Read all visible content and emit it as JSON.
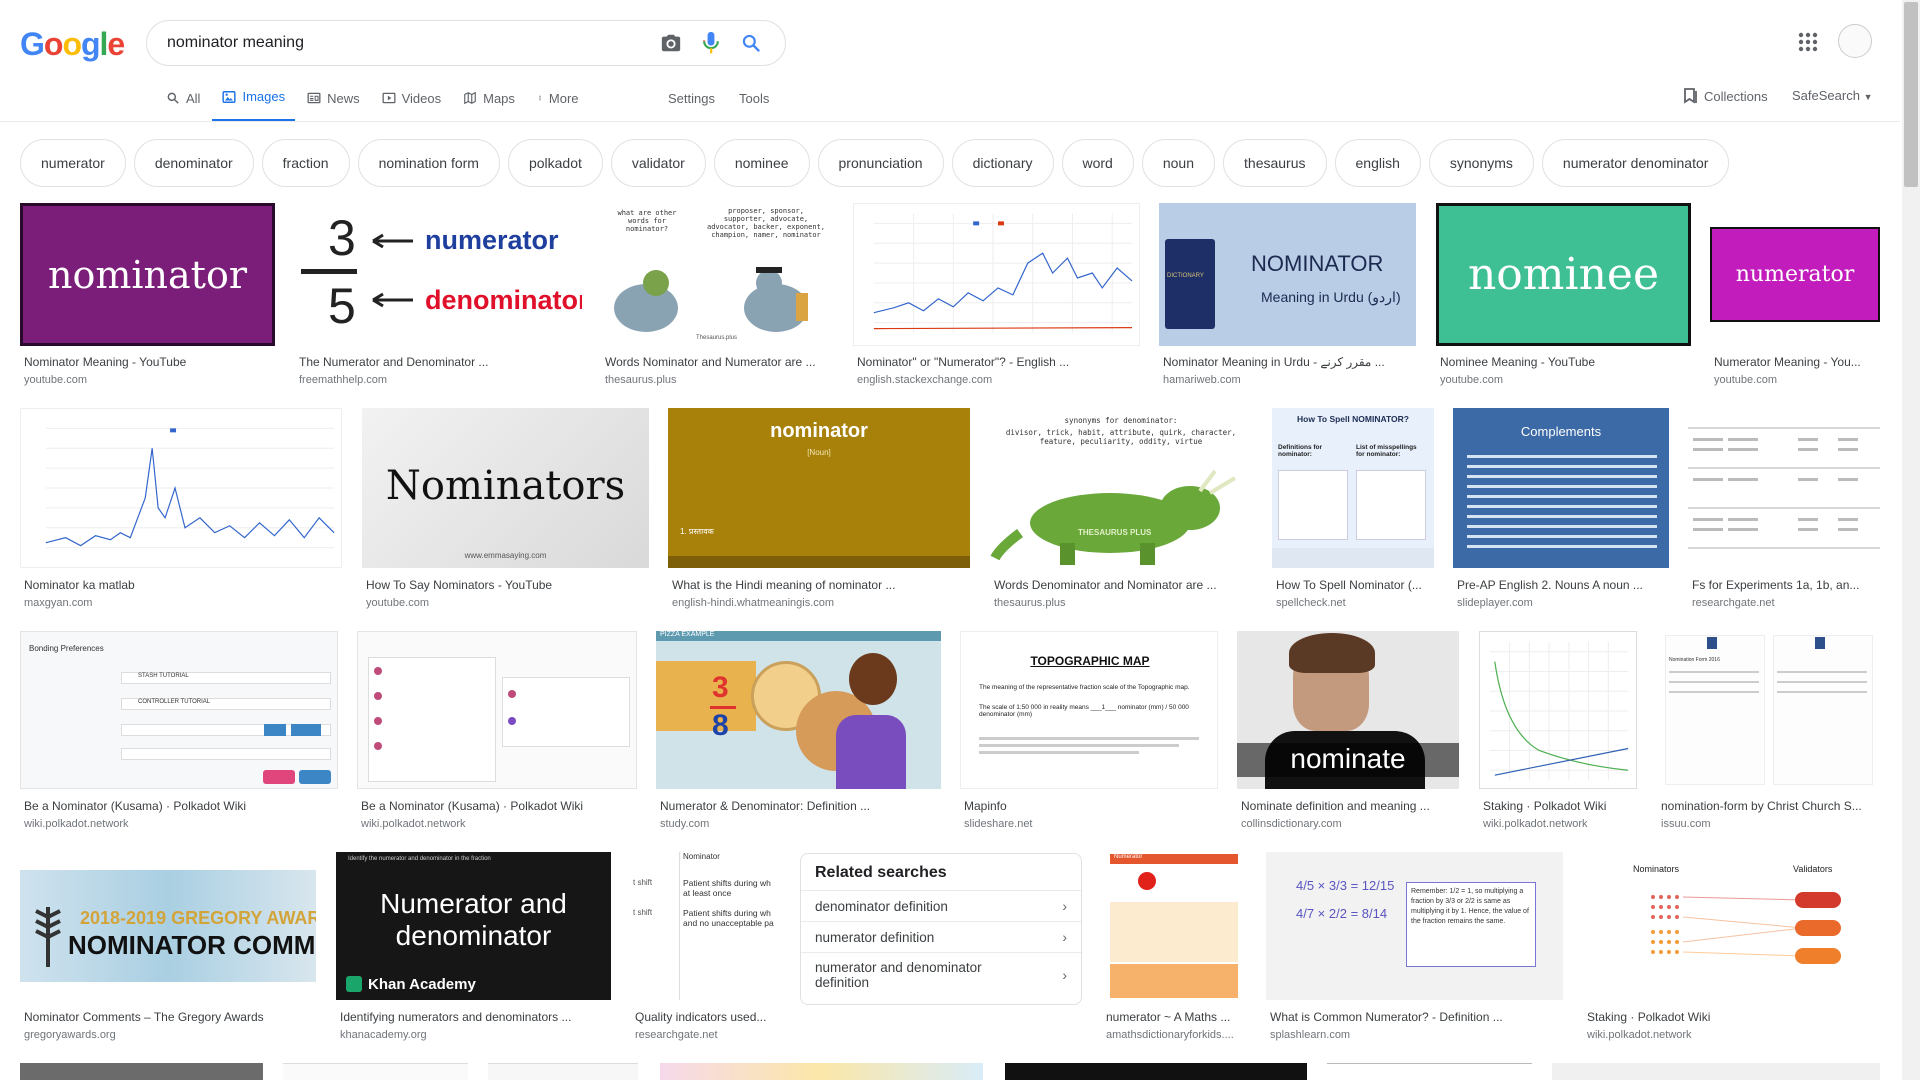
{
  "logo": [
    "G",
    "o",
    "o",
    "g",
    "l",
    "e"
  ],
  "logo_colors": [
    "#4285f4",
    "#ea4335",
    "#fbbc05",
    "#4285f4",
    "#34a853",
    "#ea4335"
  ],
  "search": {
    "value": "nominator meaning"
  },
  "tabs": [
    {
      "label": "All",
      "icon": "search-icon"
    },
    {
      "label": "Images",
      "icon": "image-icon"
    },
    {
      "label": "News",
      "icon": "news-icon"
    },
    {
      "label": "Videos",
      "icon": "video-icon"
    },
    {
      "label": "Maps",
      "icon": "map-icon"
    },
    {
      "label": "More",
      "icon": "more-vert-icon"
    }
  ],
  "tools": {
    "settings": "Settings",
    "tools": "Tools"
  },
  "collections": "Collections",
  "safesearch": "SafeSearch",
  "chips": [
    "numerator",
    "denominator",
    "fraction",
    "nomination form",
    "polkadot",
    "validator",
    "nominee",
    "pronunciation",
    "dictionary",
    "word",
    "noun",
    "thesaurus",
    "english",
    "synonyms",
    "numerator denominator"
  ],
  "results": [
    {
      "title": "Nominator Meaning - YouTube",
      "source": "youtube.com",
      "thumb_text": "nominator"
    },
    {
      "title": "The Numerator and Denominator ...",
      "source": "freemathhelp.com",
      "thumb_text": "numerator",
      "thumb_text2": "denominator",
      "num": "3",
      "den": "5"
    },
    {
      "title": "Words Nominator and Numerator are ...",
      "source": "thesaurus.plus",
      "thumb_text": "what are other words for nominator?",
      "thumb_text2": "proposer, sponsor, supporter, advocate, advocator, backer, exponent, champion, namer, nominator",
      "thumb_text3": "Thesaurus.plus"
    },
    {
      "title": "Nominator\" or \"Numerator\"? - English ...",
      "source": "english.stackexchange.com"
    },
    {
      "title": "Nominator Meaning in Urdu - مقرر کرنے ...",
      "source": "hamariweb.com",
      "thumb_text": "NOMINATOR",
      "thumb_text2": "Meaning in Urdu (اردو)",
      "thumb_text3": "DICTIONARY"
    },
    {
      "title": "Nominee Meaning - YouTube",
      "source": "youtube.com",
      "thumb_text": "nominee"
    },
    {
      "title": "Numerator Meaning - You...",
      "source": "youtube.com",
      "thumb_text": "numerator"
    },
    {
      "title": "Nominator ka matlab",
      "source": "maxgyan.com"
    },
    {
      "title": "How To Say Nominators - YouTube",
      "source": "youtube.com",
      "thumb_text": "Nominators",
      "thumb_text2": "www.emmasaying.com"
    },
    {
      "title": "What is the Hindi meaning of nominator ...",
      "source": "english-hindi.whatmeaningis.com",
      "thumb_text": "nominator",
      "thumb_text2": "[Noun]",
      "thumb_text3": "1. प्रस्तावक"
    },
    {
      "title": "Words Denominator and Nominator are ...",
      "source": "thesaurus.plus",
      "thumb_text": "synonyms for denominator:",
      "thumb_text2": "divisor, trick, habit, attribute, quirk, character, feature, peculiarity, oddity, virtue",
      "thumb_text3": "THESAURUS PLUS"
    },
    {
      "title": "How To Spell Nominator (...",
      "source": "spellcheck.net",
      "thumb_text": "How To Spell NOMINATOR?",
      "thumb_text2": "Definitions for nominator:",
      "thumb_text3": "List of misspellings for nominator:"
    },
    {
      "title": "Pre-AP English 2. Nouns A noun ...",
      "source": "slideplayer.com",
      "thumb_text": "Complements"
    },
    {
      "title": "Fs for Experiments 1a, 1b, an...",
      "source": "researchgate.net"
    },
    {
      "title": "Be a Nominator (Kusama) · Polkadot Wiki",
      "source": "wiki.polkadot.network",
      "thumb_text": "Bonding Preferences",
      "thumb_text2": "STASH TUTORIAL",
      "thumb_text3": "CONTROLLER TUTORIAL"
    },
    {
      "title": "Be a Nominator (Kusama) · Polkadot Wiki",
      "source": "wiki.polkadot.network"
    },
    {
      "title": "Numerator & Denominator: Definition ...",
      "source": "study.com",
      "thumb_text": "PIZZA EXAMPLE",
      "num": "3",
      "den": "8"
    },
    {
      "title": "Mapinfo",
      "source": "slideshare.net",
      "thumb_text": "TOPOGRAPHIC MAP",
      "thumb_text2": "The meaning of the representative fraction scale of the Topographic map.",
      "thumb_text3": "The scale of 1:50 000 in reality means ___1___ nominator (mm) / 50 000 denominator (mm)"
    },
    {
      "title": "Nominate definition and meaning ...",
      "source": "collinsdictionary.com",
      "thumb_text": "nominate"
    },
    {
      "title": "Staking · Polkadot Wiki",
      "source": "wiki.polkadot.network"
    },
    {
      "title": "nomination-form by Christ Church S...",
      "source": "issuu.com",
      "thumb_text": "Nomination Form 2016"
    },
    {
      "title": "Nominator Comments – The Gregory Awards",
      "source": "gregoryawards.org",
      "thumb_text": "2018-2019 GREGORY AWAR",
      "thumb_text2": "NOMINATOR COMME"
    },
    {
      "title": "Identifying numerators and denominators ...",
      "source": "khanacademy.org",
      "thumb_text": "Numerator and denominator",
      "thumb_text2": "Khan Academy",
      "thumb_text3": "Identify the numerator and denominator in the fraction"
    },
    {
      "title": "Quality indicators used...",
      "source": "researchgate.net",
      "thumb_text": "Nominator",
      "thumb_text2": "Patient shifts during wh at least once",
      "thumb_text3": "Patient shifts during wh and no unacceptable pa"
    },
    {
      "title": "numerator ~ A Maths ...",
      "source": "amathsdictionaryforkids....",
      "thumb_text": "Numerator"
    },
    {
      "title": "What is Common Numerator? - Definition ...",
      "source": "splashlearn.com",
      "thumb_text": "Remember: 1/2 = 1, so multiplying a fraction by 3/3 or 2/2 is same as multiplying it by 1. Hence, the value of the fraction remains the same."
    },
    {
      "title": "Staking · Polkadot Wiki",
      "source": "wiki.polkadot.network",
      "thumb_text": "Nominators",
      "thumb_text2": "Validators"
    }
  ],
  "related": {
    "title": "Related searches",
    "items": [
      "denominator definition",
      "numerator definition",
      "numerator and denominator definition"
    ]
  },
  "colors": {
    "accent": "#1a73e8",
    "purple": "#7b1e7a",
    "magenta": "#c21dbc",
    "teal": "#3fbf94",
    "khan": "#1a1a1a"
  }
}
